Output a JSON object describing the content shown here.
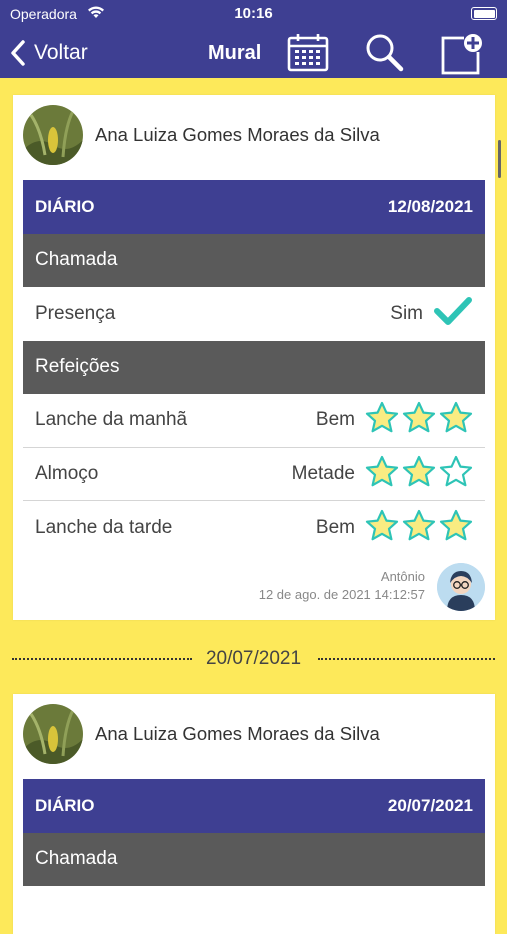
{
  "status_bar": {
    "carrier": "Operadora",
    "time": "10:16"
  },
  "nav": {
    "back_label": "Voltar",
    "title": "Mural"
  },
  "posts": [
    {
      "author": "Ana Luiza Gomes Moraes da Silva",
      "header_label": "DIÁRIO",
      "date": "12/08/2021",
      "sections": {
        "chamada": "Chamada",
        "presenca_label": "Presença",
        "presenca_value": "Sim",
        "refeicoes": "Refeições"
      },
      "meals": [
        {
          "label": "Lanche da manhã",
          "value": "Bem",
          "rating": 3
        },
        {
          "label": "Almoço",
          "value": "Metade",
          "rating": 2
        },
        {
          "label": "Lanche da tarde",
          "value": "Bem",
          "rating": 3
        }
      ],
      "posted_by": "Antônio",
      "posted_at": "12 de ago. de 2021 14:12:57"
    },
    {
      "author": "Ana Luiza Gomes Moraes da Silva",
      "header_label": "DIÁRIO",
      "date": "20/07/2021",
      "sections": {
        "chamada": "Chamada"
      }
    }
  ],
  "date_separator": "20/07/2021",
  "colors": {
    "header": "#3e3f92",
    "background": "#fde95a",
    "section": "#5a5a5a",
    "star": "#f9ec82",
    "check": "#2ec4b6"
  }
}
